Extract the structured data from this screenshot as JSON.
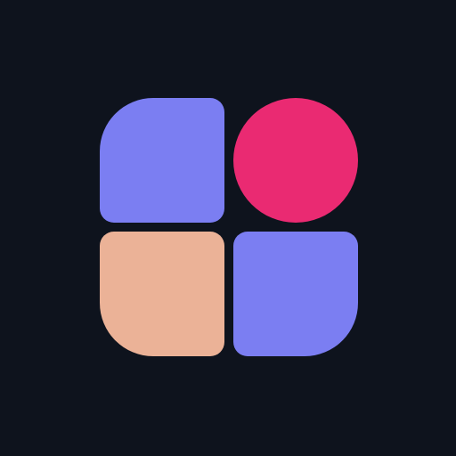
{
  "logo": {
    "background_color": "#0e131d",
    "shapes": [
      {
        "id": "top-left",
        "form": "rounded-square-large-top-left-corner",
        "color": "#7b7ef2"
      },
      {
        "id": "top-right",
        "form": "circle",
        "color": "#ea2a72"
      },
      {
        "id": "bottom-left",
        "form": "rounded-square-large-bottom-left-corner",
        "color": "#ebb297"
      },
      {
        "id": "bottom-right",
        "form": "rounded-square-large-bottom-right-corner",
        "color": "#7b7ef2"
      }
    ]
  }
}
